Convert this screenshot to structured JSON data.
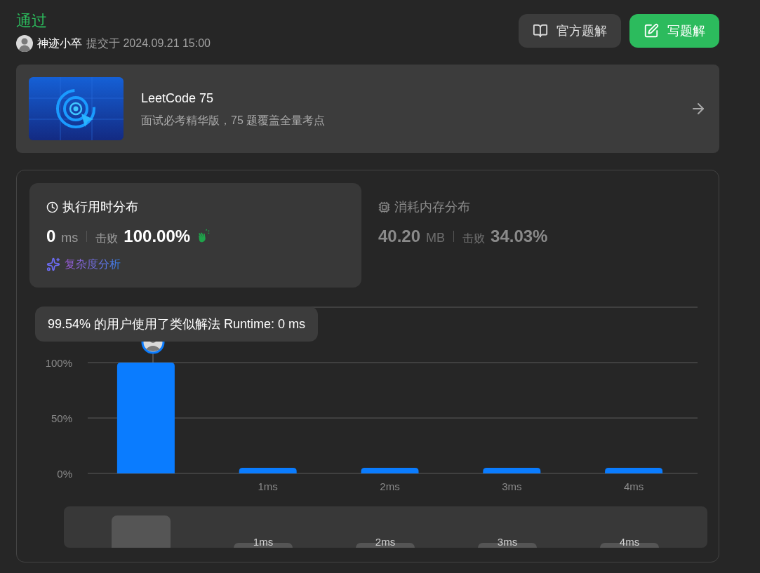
{
  "status": "通过",
  "submitter": {
    "name": "神迹小卒",
    "submitted_at": "提交于 2024.09.21 15:00"
  },
  "buttons": [
    {
      "label": "官方题解",
      "kind": "secondary"
    },
    {
      "label": "写题解",
      "kind": "primary"
    }
  ],
  "banner": {
    "title": "LeetCode 75",
    "subtitle": "面试必考精华版，75 题覆盖全量考点"
  },
  "stats": [
    {
      "kind": "time",
      "title": "执行用时分布",
      "value": "0",
      "unit": "ms",
      "beats_label": "击败",
      "beats": "100.00%",
      "selected": true,
      "analysis_link": "复杂度分析"
    },
    {
      "kind": "memory",
      "title": "消耗内存分布",
      "value": "40.20",
      "unit": "MB",
      "beats_label": "击败",
      "beats": "34.03%",
      "selected": false
    }
  ],
  "chart": {
    "tooltip": "99.54% 的用户使用了类似解法 Runtime: 0 ms",
    "chart_data": {
      "type": "bar",
      "categories": [
        null,
        "1ms",
        "2ms",
        "3ms",
        "4ms"
      ],
      "series": [
        {
          "color": "#0a7cff",
          "values": [
            100,
            5,
            5,
            5,
            5
          ]
        }
      ],
      "ylim": [
        0,
        150
      ],
      "yticks": [
        {
          "value": 0,
          "label": "0%"
        },
        {
          "value": 50,
          "label": "50%"
        },
        {
          "value": 100,
          "label": "100%"
        }
      ]
    }
  },
  "overview": {
    "labels": [
      "1ms",
      "2ms",
      "3ms",
      "4ms"
    ]
  }
}
